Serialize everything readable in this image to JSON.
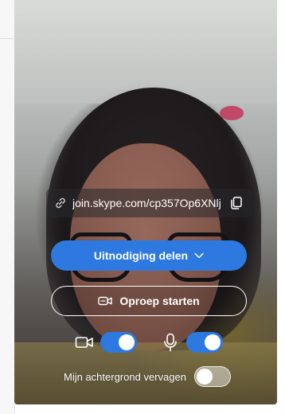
{
  "link": {
    "url": "join.skype.com/cp357Op6XNlj",
    "link_icon": "link-icon",
    "copy_icon": "copy-icon"
  },
  "actions": {
    "invite_label": "Uitnodiging delen",
    "invite_icon": "chevron-down-icon",
    "start_call_label": "Oproep starten",
    "start_call_icon": "video-call-icon"
  },
  "toggles": {
    "video": {
      "icon": "video-camera-icon",
      "on": true
    },
    "mic": {
      "icon": "microphone-icon",
      "on": true
    },
    "blur_background": {
      "label": "Mijn achtergrond vervagen",
      "on": false
    }
  },
  "colors": {
    "accent": "#2e79e0",
    "text_on_video": "#ffffff"
  }
}
